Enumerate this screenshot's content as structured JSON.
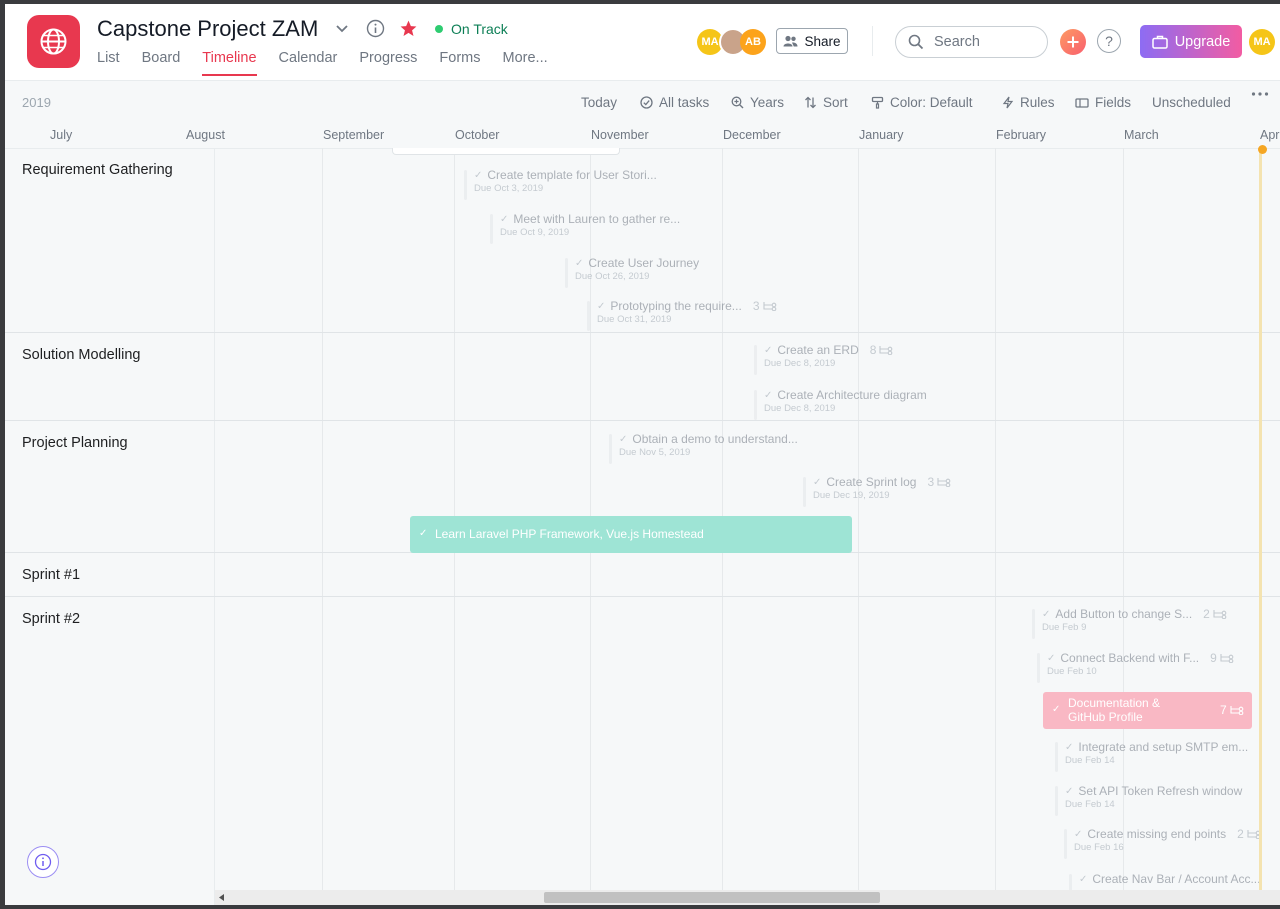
{
  "project": {
    "title": "Capstone Project ZAM",
    "status": "On Track"
  },
  "tabs": [
    "List",
    "Board",
    "Timeline",
    "Calendar",
    "Progress",
    "Forms",
    "More..."
  ],
  "header": {
    "avatars": [
      "MA",
      "AB"
    ],
    "share_label": "Share",
    "search_placeholder": "Search",
    "help_label": "?",
    "upgrade_label": "Upgrade",
    "user_avatar": "MA"
  },
  "toolbar": {
    "year": "2019",
    "today": "Today",
    "all_tasks": "All tasks",
    "years": "Years",
    "sort": "Sort",
    "color": "Color: Default",
    "rules": "Rules",
    "fields": "Fields",
    "unscheduled": "Unscheduled"
  },
  "months": [
    "July",
    "August",
    "September",
    "October",
    "November",
    "December",
    "January",
    "February",
    "March",
    "Apr"
  ],
  "sections": [
    "Requirement Gathering",
    "Solution Modelling",
    "Project Planning",
    "Sprint #1",
    "Sprint #2"
  ],
  "tasks": [
    {
      "name": "Create template for User Stori...",
      "due": "Due Oct 3, 2019",
      "subtasks": ""
    },
    {
      "name": "Meet with Lauren to gather re...",
      "due": "Due Oct 9, 2019",
      "subtasks": ""
    },
    {
      "name": "Create User Journey",
      "due": "Due Oct 26, 2019",
      "subtasks": ""
    },
    {
      "name": "Prototyping the require...",
      "due": "Due Oct 31, 2019",
      "subtasks": "3"
    },
    {
      "name": "Create an ERD",
      "due": "Due Dec 8, 2019",
      "subtasks": "8"
    },
    {
      "name": "Create Architecture diagram",
      "due": "Due Dec 8, 2019",
      "subtasks": ""
    },
    {
      "name": "Obtain a demo to understand...",
      "due": "Due Nov 5, 2019",
      "subtasks": ""
    },
    {
      "name": "Create Sprint log",
      "due": "Due Dec 19, 2019",
      "subtasks": "3"
    },
    {
      "name": "Add Button to change S...",
      "due": "Due Feb 9",
      "subtasks": "2"
    },
    {
      "name": "Connect Backend with F...",
      "due": "Due Feb 10",
      "subtasks": "9"
    },
    {
      "name": "Integrate and setup SMTP em...",
      "due": "Due Feb 14",
      "subtasks": ""
    },
    {
      "name": "Set API Token Refresh window",
      "due": "Due Feb 14",
      "subtasks": ""
    },
    {
      "name": "Create missing end points",
      "due": "Due Feb 16",
      "subtasks": "2"
    },
    {
      "name": "Create Nav Bar / Account Acc...",
      "due": "",
      "subtasks": ""
    }
  ],
  "highlight_tasks": {
    "laravel": {
      "name": "Learn Laravel PHP Framework, Vue.js Homestead",
      "color": "#9ee4d5"
    },
    "docs": {
      "name": "Documentation & GitHub Profile",
      "subtasks": "7",
      "color": "#f9b8c4"
    }
  },
  "colors": {
    "accent": "#e8384f",
    "status_green": "#0d7f56",
    "avatar_ma": "#f5c518",
    "avatar_ab": "#fca31b"
  }
}
